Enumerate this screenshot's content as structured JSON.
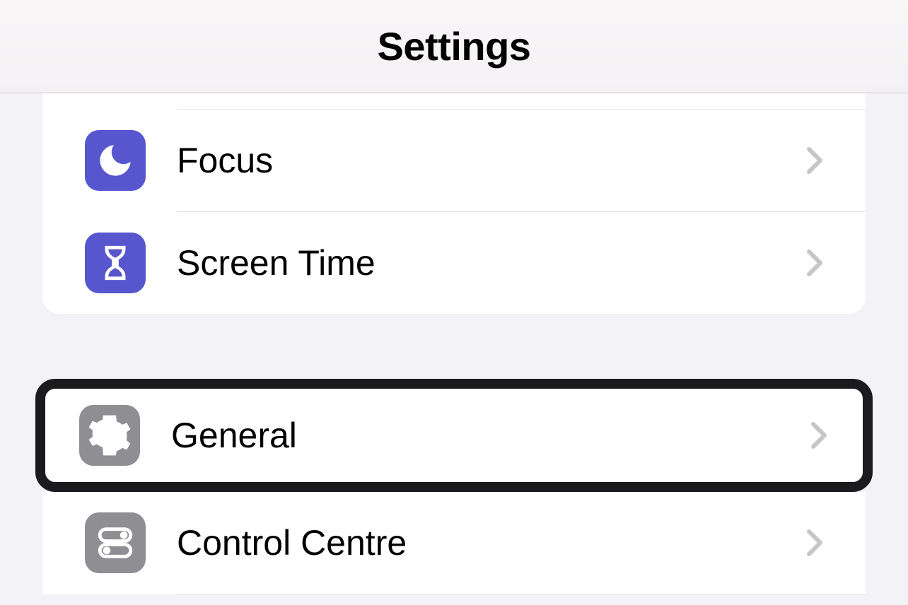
{
  "header": {
    "title": "Settings"
  },
  "group1": {
    "items": [
      {
        "label": "Focus"
      },
      {
        "label": "Screen Time"
      }
    ]
  },
  "group2": {
    "items": [
      {
        "label": "General"
      },
      {
        "label": "Control Centre"
      }
    ]
  }
}
